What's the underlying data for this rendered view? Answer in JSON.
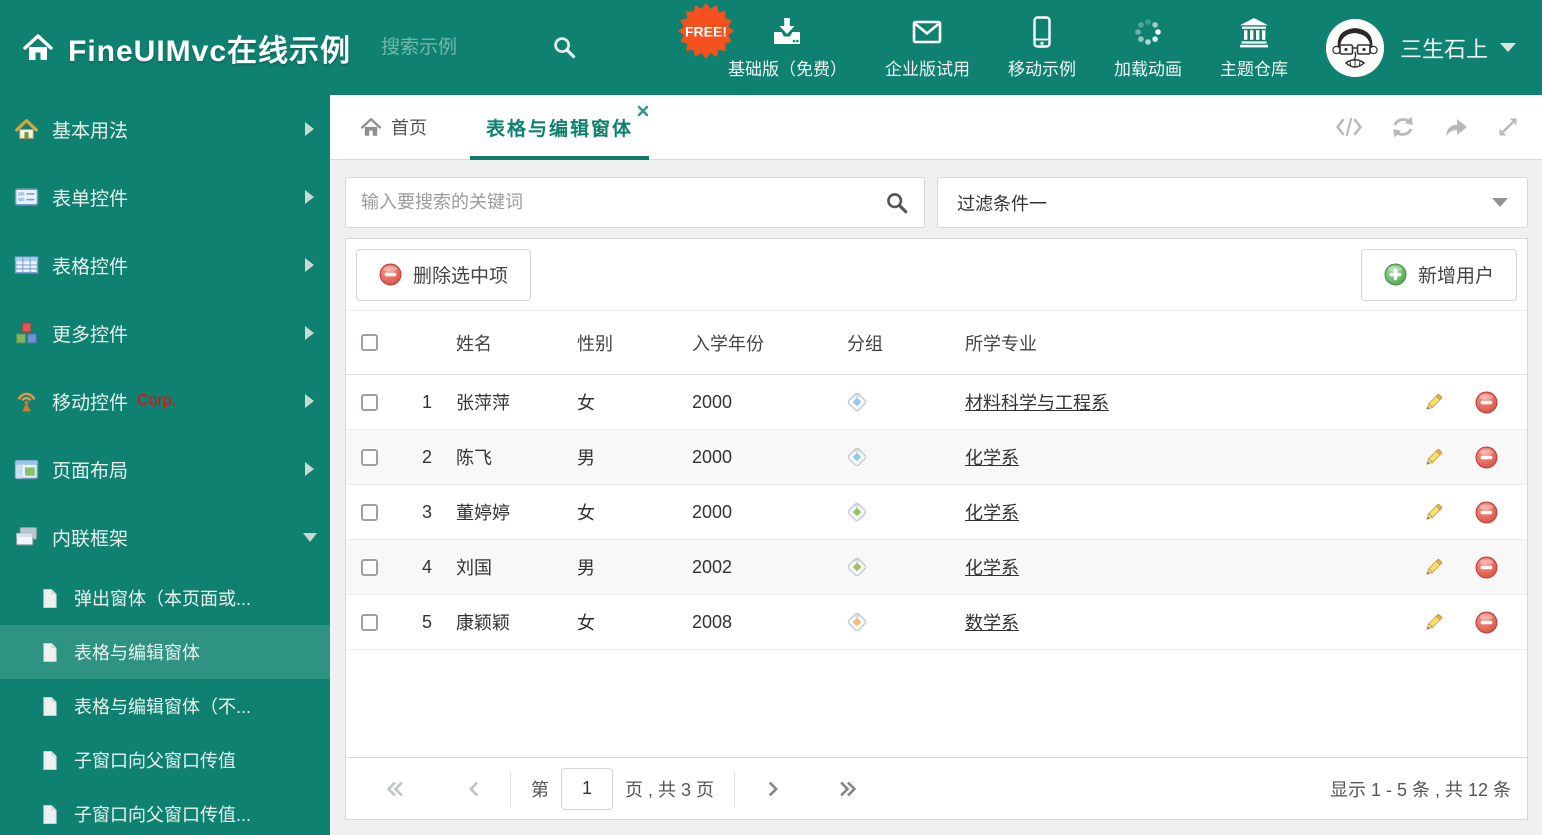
{
  "header": {
    "title": "FineUIMvc在线示例",
    "search_placeholder": "搜索示例",
    "free_badge": "FREE!",
    "nav_items": [
      {
        "icon": "download-icon",
        "label": "基础版（免费）"
      },
      {
        "icon": "envelope-icon",
        "label": "企业版试用"
      },
      {
        "icon": "mobile-icon",
        "label": "移动示例"
      },
      {
        "icon": "spinner-icon",
        "label": "加载动画"
      },
      {
        "icon": "bank-icon",
        "label": "主题仓库"
      }
    ],
    "user_name": "三生石上"
  },
  "sidebar": {
    "items": [
      {
        "icon": "house-icon",
        "label": "基本用法"
      },
      {
        "icon": "form-icon",
        "label": "表单控件"
      },
      {
        "icon": "table-icon",
        "label": "表格控件"
      },
      {
        "icon": "cubes-icon",
        "label": "更多控件"
      },
      {
        "icon": "antenna-icon",
        "label": "移动控件",
        "badge": "Corp."
      },
      {
        "icon": "layout-icon",
        "label": "页面布局"
      },
      {
        "icon": "frames-icon",
        "label": "内联框架"
      }
    ],
    "subitems": [
      {
        "label": "弹出窗体（本页面或..."
      },
      {
        "label": "表格与编辑窗体",
        "selected": true
      },
      {
        "label": "表格与编辑窗体（不..."
      },
      {
        "label": "子窗口向父窗口传值"
      },
      {
        "label": "子窗口向父窗口传值..."
      }
    ]
  },
  "tabs": {
    "home_label": "首页",
    "active_label": "表格与编辑窗体"
  },
  "tab_toolbar_icons": [
    "code-icon",
    "refresh-icon",
    "forward-icon",
    "fullscreen-icon"
  ],
  "filters": {
    "keyword_placeholder": "输入要搜索的关键词",
    "filter_value": "过滤条件一"
  },
  "grid": {
    "delete_button_label": "删除选中项",
    "add_button_label": "新增用户",
    "columns": [
      "姓名",
      "性别",
      "入学年份",
      "分组",
      "所学专业"
    ],
    "rows": [
      {
        "num": "1",
        "name": "张萍萍",
        "gender": "女",
        "year": "2000",
        "tag_color": "#8ec9f0",
        "major": "材料科学与工程系"
      },
      {
        "num": "2",
        "name": "陈飞",
        "gender": "男",
        "year": "2000",
        "tag_color": "#8ec9f0",
        "major": "化学系"
      },
      {
        "num": "3",
        "name": "董婷婷",
        "gender": "女",
        "year": "2000",
        "tag_color": "#9cc45c",
        "major": "化学系"
      },
      {
        "num": "4",
        "name": "刘国",
        "gender": "男",
        "year": "2002",
        "tag_color": "#9cc45c",
        "major": "化学系"
      },
      {
        "num": "5",
        "name": "康颖颖",
        "gender": "女",
        "year": "2008",
        "tag_color": "#f6bb77",
        "major": "数学系"
      }
    ]
  },
  "pagination": {
    "page_prefix": "第",
    "page_value": "1",
    "page_suffix": "页 , 共 3 页",
    "summary": "显示 1 - 5 条 , 共 12 条"
  },
  "colors": {
    "theme": "#0f8170",
    "sidebar_selected": "#2e9381",
    "active_tab": "#0e7a68",
    "free_badge": "#f4511e",
    "corp_badge": "#ff0000"
  }
}
